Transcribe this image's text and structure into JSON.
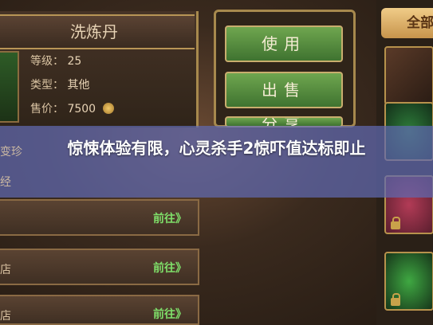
{
  "item_panel": {
    "name": "洗炼丹",
    "level_label": "等级：",
    "level_value": "25",
    "type_label": "类型：",
    "type_value": "其他",
    "price_label": "售价：",
    "price_value": "7500"
  },
  "buttons": {
    "use": "使用",
    "sell": "出售",
    "share": "分享"
  },
  "right_tabs": {
    "all": "全部"
  },
  "side_labels": {
    "row1": "变珍",
    "row2": "经",
    "row3_goto": "前往》",
    "row4_label": "店",
    "row4_goto": "前往》",
    "row5_label": "店",
    "row5_goto": "前往》"
  },
  "overlay": {
    "headline": "惊悚体验有限，心灵杀手2惊吓值达标即止"
  },
  "colors": {
    "overlay": "#606ab2",
    "button_green": "#4f8a3c",
    "goto_green": "#7fe06a",
    "tab_gold": "#e2b46e"
  }
}
